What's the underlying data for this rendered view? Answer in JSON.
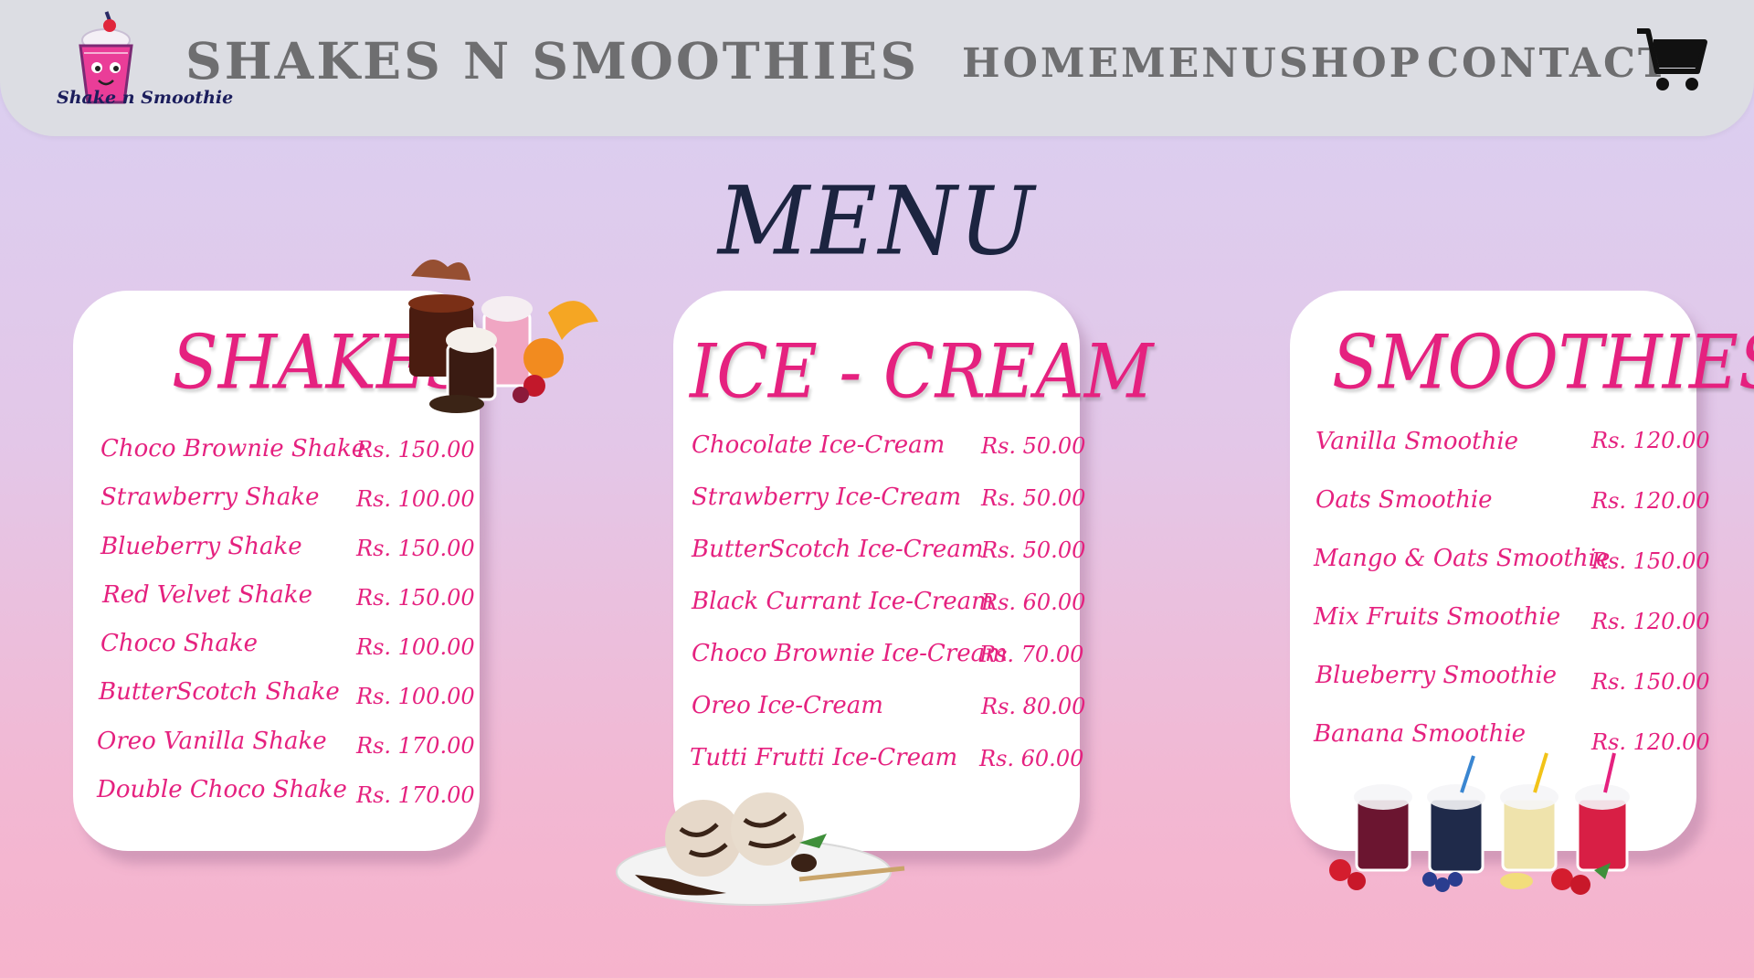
{
  "header": {
    "logo_text": "Shake n Smoothie",
    "brand": "SHAKES N SMOOTHIES",
    "nav": [
      "HOME",
      "MENU",
      "SHOP",
      "CONTACT"
    ]
  },
  "page_title": "MENU",
  "sections": {
    "shakes": {
      "title": "SHAKES",
      "items": [
        {
          "name": "Choco Brownie Shake",
          "price": "Rs. 150.00"
        },
        {
          "name": "Strawberry Shake",
          "price": "Rs. 100.00"
        },
        {
          "name": "Blueberry Shake",
          "price": "Rs. 150.00"
        },
        {
          "name": "Red Velvet Shake",
          "price": "Rs. 150.00"
        },
        {
          "name": "Choco Shake",
          "price": "Rs. 100.00"
        },
        {
          "name": "ButterScotch Shake",
          "price": "Rs. 100.00"
        },
        {
          "name": "Oreo Vanilla Shake",
          "price": "Rs. 170.00"
        },
        {
          "name": "Double Choco Shake",
          "price": "Rs. 170.00"
        }
      ]
    },
    "icecream": {
      "title": "ICE - CREAM",
      "items": [
        {
          "name": "Chocolate Ice-Cream",
          "price": "Rs. 50.00"
        },
        {
          "name": "Strawberry Ice-Cream",
          "price": "Rs. 50.00"
        },
        {
          "name": "ButterScotch Ice-Cream",
          "price": "Rs. 50.00"
        },
        {
          "name": "Black Currant Ice-Cream",
          "price": "Rs. 60.00"
        },
        {
          "name": "Choco Brownie Ice-Cream",
          "price": "Rs. 70.00"
        },
        {
          "name": "Oreo Ice-Cream",
          "price": "Rs. 80.00"
        },
        {
          "name": "Tutti Frutti Ice-Cream",
          "price": "Rs. 60.00"
        }
      ]
    },
    "smoothies": {
      "title": "SMOOTHIES",
      "items": [
        {
          "name": "Vanilla Smoothie",
          "price": "Rs. 120.00"
        },
        {
          "name": "Oats Smoothie",
          "price": "Rs. 120.00"
        },
        {
          "name": "Mango & Oats Smoothie",
          "price": "Rs. 150.00"
        },
        {
          "name": "Mix Fruits Smoothie",
          "price": "Rs. 120.00"
        },
        {
          "name": "Blueberry Smoothie",
          "price": "Rs. 150.00"
        },
        {
          "name": "Banana Smoothie",
          "price": "Rs. 120.00"
        }
      ]
    }
  },
  "icons": {
    "logo": "milkshake-mascot-icon",
    "cart": "shopping-cart-icon"
  },
  "colors": {
    "accent": "#e5217f",
    "heading": "#1c2440",
    "nav_text": "#6e6e70",
    "navbar_bg": "#dcdde3"
  }
}
